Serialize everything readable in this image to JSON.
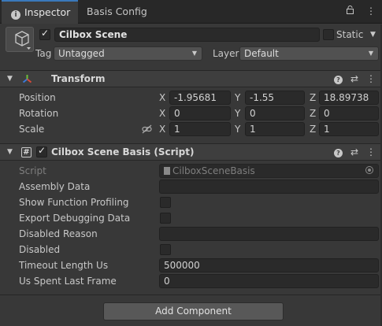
{
  "tabs": {
    "inspector": "Inspector",
    "basis_config": "Basis Config"
  },
  "header": {
    "name": "Cilbox Scene",
    "active": true,
    "static_label": "Static",
    "tag_label": "Tag",
    "tag_value": "Untagged",
    "layer_label": "Layer",
    "layer_value": "Default"
  },
  "transform": {
    "title": "Transform",
    "position_label": "Position",
    "rotation_label": "Rotation",
    "scale_label": "Scale",
    "axes": {
      "x": "X",
      "y": "Y",
      "z": "Z"
    },
    "position": {
      "x": "-1.95681",
      "y": "-1.55",
      "z": "18.89738"
    },
    "rotation": {
      "x": "0",
      "y": "0",
      "z": "0"
    },
    "scale": {
      "x": "1",
      "y": "1",
      "z": "1"
    }
  },
  "script_component": {
    "title": "Cilbox Scene Basis (Script)",
    "enabled": true,
    "script_label": "Script",
    "script_value": "CilboxSceneBasis",
    "fields": [
      {
        "label": "Assembly Data",
        "type": "text",
        "value": ""
      },
      {
        "label": "Show Function Profiling",
        "type": "bool",
        "value": false
      },
      {
        "label": "Export Debugging Data",
        "type": "bool",
        "value": false
      },
      {
        "label": "Disabled Reason",
        "type": "text",
        "value": ""
      },
      {
        "label": "Disabled",
        "type": "bool",
        "value": false
      },
      {
        "label": "Timeout Length Us",
        "type": "text",
        "value": "500000"
      },
      {
        "label": "Us Spent Last Frame",
        "type": "text",
        "value": "0"
      }
    ]
  },
  "add_component_label": "Add Component",
  "colors": {
    "background": "#383838",
    "field": "#2a2a2a",
    "tab_accent": "#3a79bb",
    "header_bg": "#3e3e3e"
  }
}
